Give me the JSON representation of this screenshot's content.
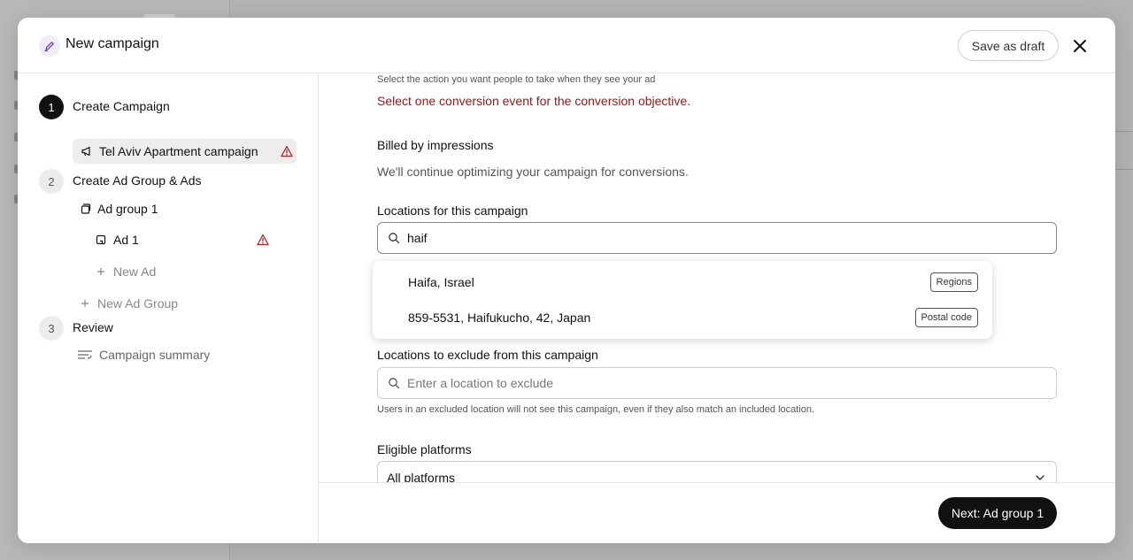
{
  "modal": {
    "title": "New campaign",
    "save_draft_label": "Save as draft",
    "close_icon": "close-icon"
  },
  "nav": {
    "steps": [
      {
        "number": "1",
        "label": "Create Campaign"
      },
      {
        "number": "2",
        "label": "Create Ad Group & Ads"
      },
      {
        "number": "3",
        "label": "Review"
      }
    ],
    "campaign_item": "Tel Aviv Apartment campaign",
    "ad_group_item": "Ad group 1",
    "ad_item": "Ad 1",
    "new_ad": "New Ad",
    "new_ad_group": "New Ad Group",
    "campaign_summary": "Campaign summary"
  },
  "content": {
    "action_helper": "Select the action you want people to take when they see your ad",
    "conversion_error": "Select one conversion event for the conversion objective.",
    "billing_title": "Billed by impressions",
    "billing_desc": "We'll continue optimizing your campaign for conversions.",
    "locations_label": "Locations for this campaign",
    "locations_value": "haif",
    "exclude_label": "Locations to exclude from this campaign",
    "exclude_placeholder": "Enter a location to exclude",
    "exclude_helper": "Users in an excluded location will not see this campaign, even if they also match an included location.",
    "platforms_label": "Eligible platforms",
    "platforms_value": "All platforms"
  },
  "dropdown": {
    "options": [
      {
        "label": "Haifa, Israel",
        "tag": "Regions"
      },
      {
        "label": "859-5531, Haifukucho, 42, Japan",
        "tag": "Postal code"
      }
    ]
  },
  "footer": {
    "next_label": "Next: Ad group 1"
  },
  "colors": {
    "error": "#8b1a1a",
    "primary_button": "#111111",
    "warning_icon": "#a3262a"
  }
}
